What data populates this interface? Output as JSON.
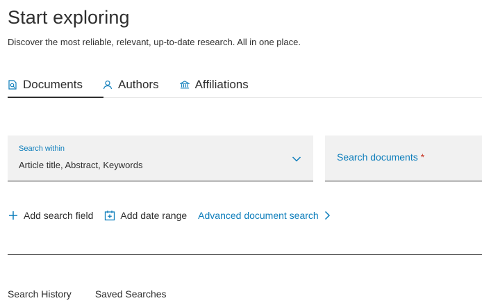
{
  "header": {
    "title": "Start exploring",
    "subtitle": "Discover the most reliable, relevant, up-to-date research. All in one place."
  },
  "tabs": [
    {
      "label": "Documents",
      "icon": "document-search-icon",
      "active": true
    },
    {
      "label": "Authors",
      "icon": "person-icon",
      "active": false
    },
    {
      "label": "Affiliations",
      "icon": "institution-icon",
      "active": false
    }
  ],
  "search_within": {
    "label": "Search within",
    "value": "Article title, Abstract, Keywords",
    "icon": "chevron-down-icon"
  },
  "search_documents": {
    "placeholder": "Search documents",
    "required_mark": "*"
  },
  "actions": {
    "add_field": "Add search field",
    "add_date": "Add date range",
    "advanced": "Advanced document search"
  },
  "footer_links": {
    "history": "Search History",
    "saved": "Saved Searches"
  },
  "colors": {
    "accent": "#0c7dbb",
    "text": "#2e2e2e",
    "field_bg": "#f1f1f1",
    "required": "#c83727"
  }
}
